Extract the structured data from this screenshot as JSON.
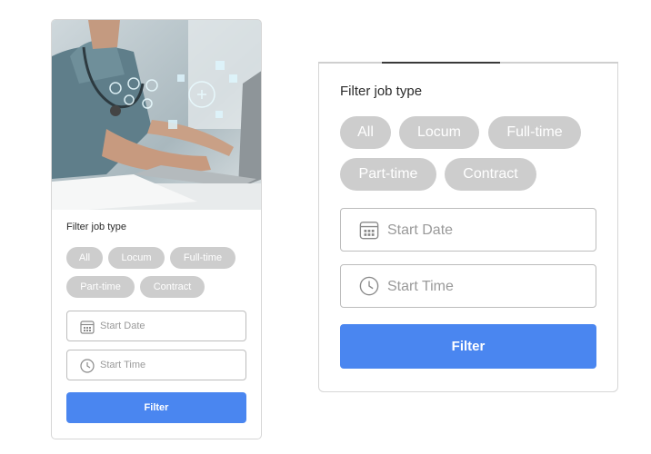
{
  "filter": {
    "title": "Filter job type",
    "job_types": [
      "All",
      "Locum",
      "Full-time",
      "Part-time",
      "Contract"
    ],
    "start_date_placeholder": "Start Date",
    "start_time_placeholder": "Start Time",
    "submit_label": "Filter"
  },
  "icons": {
    "date": "calendar-icon",
    "time": "clock-icon"
  },
  "colors": {
    "chip": "#cdcdcd",
    "button": "#4a86f0",
    "border": "#d6d6d6"
  }
}
